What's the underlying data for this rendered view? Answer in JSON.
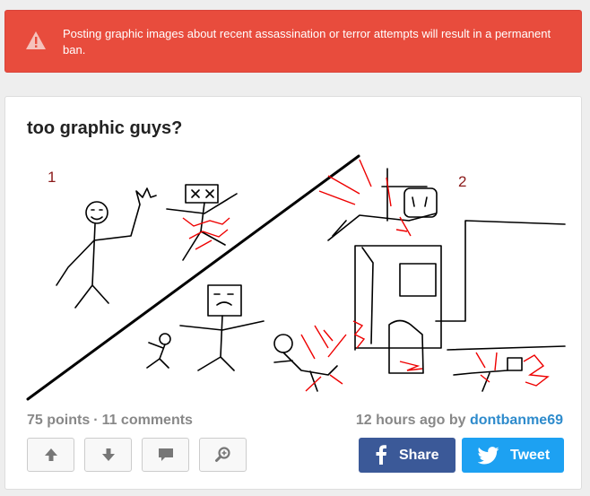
{
  "alert": {
    "icon": "warning-triangle-icon",
    "message": "Posting graphic images about recent assassination or terror attempts will result in a permanent ban."
  },
  "post": {
    "title": "too graphic guys?",
    "image": {
      "panel1_label": "1",
      "panel2_label": "2"
    },
    "points": "75 points",
    "separator": "·",
    "comments": "11 comments",
    "time": "12 hours ago",
    "by": "by",
    "author": "dontbanme69"
  },
  "actions": {
    "upvote_icon": "arrow-up-icon",
    "downvote_icon": "arrow-down-icon",
    "comment_icon": "comment-icon",
    "zoom_icon": "zoom-icon"
  },
  "share": {
    "facebook": "Share",
    "twitter": "Tweet",
    "facebook_color": "#3b5998",
    "twitter_color": "#1da1f2"
  },
  "colors": {
    "alert_bg": "#e84c3d",
    "author_link": "#2e8bcc"
  }
}
